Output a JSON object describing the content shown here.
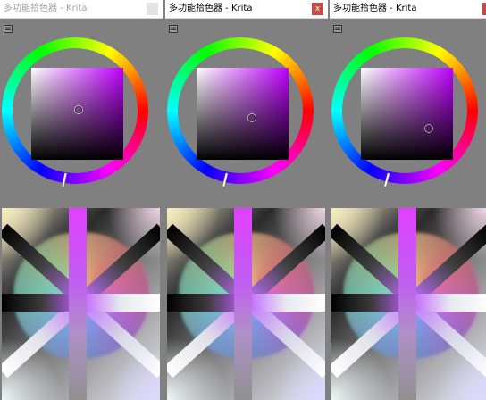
{
  "panels": [
    {
      "title": "多功能拾色器 - Krita",
      "active": false,
      "close_label": "x"
    },
    {
      "title": "多功能拾色器 - Krita",
      "active": true,
      "close_label": "x"
    },
    {
      "title": "多功能拾色器 - Krita",
      "active": true,
      "close_label": ""
    }
  ],
  "colors": {
    "background": "#808080",
    "close_active": "#c54a47",
    "hue_accent": "#c000ff"
  },
  "icons": [
    "menu-icon",
    "close-icon"
  ]
}
